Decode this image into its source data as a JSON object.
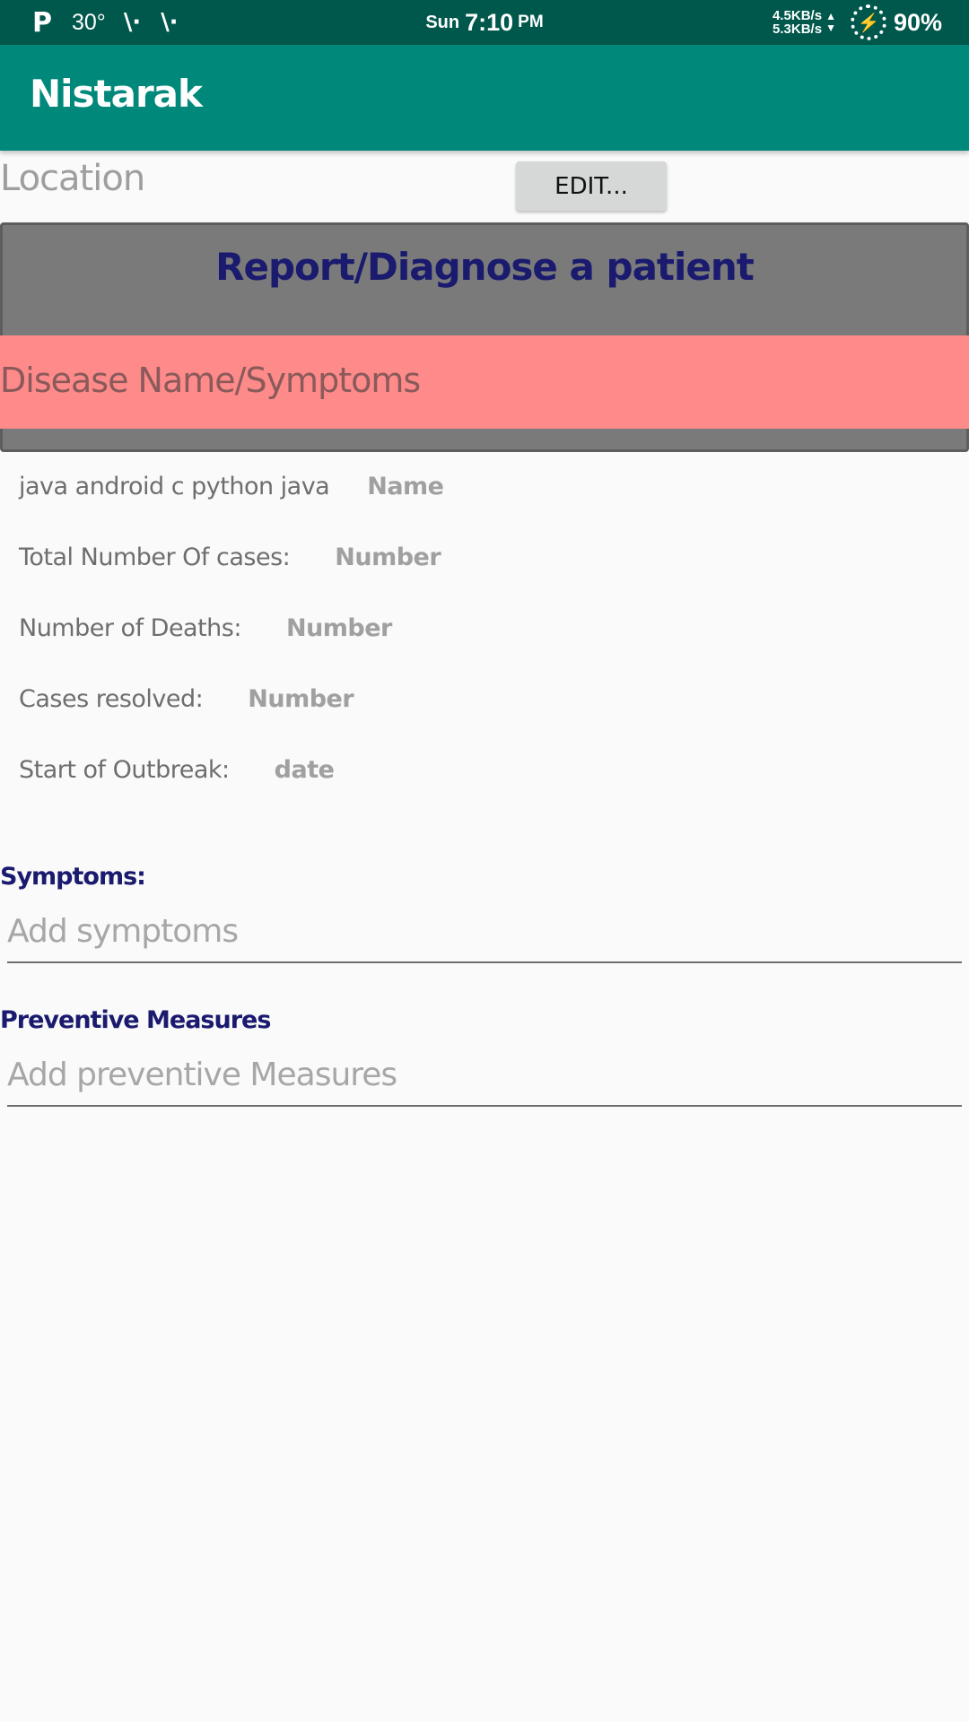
{
  "status_bar": {
    "p_icon": "P",
    "temperature": "30°",
    "signal_icons": [
      "\\·",
      "\\·"
    ],
    "day": "Sun",
    "time": "7:10",
    "ampm": "PM",
    "upload_speed": "4.5KB/s",
    "download_speed": "5.3KB/s",
    "battery": "90%"
  },
  "app_bar": {
    "title": "Nistarak"
  },
  "location": {
    "label": "Location",
    "edit_button": "EDIT..."
  },
  "report": {
    "title": "Report/Diagnose a patient",
    "disease_label": "Disease Name/Symptoms"
  },
  "stats": [
    {
      "label": "java android c python java",
      "value": "Name"
    },
    {
      "label": "Total Number Of cases:",
      "value": "Number"
    },
    {
      "label": "Number of Deaths:",
      "value": "Number"
    },
    {
      "label": "Cases resolved:",
      "value": "Number"
    },
    {
      "label": "Start of Outbreak:",
      "value": "date"
    }
  ],
  "symptoms": {
    "heading": "Symptoms:",
    "placeholder": "Add symptoms"
  },
  "preventive": {
    "heading": "Preventive Measures",
    "placeholder": "Add preventive Measures"
  },
  "colors": {
    "status_bar": "#00574b",
    "app_bar": "#00897b",
    "report_card": "#7a7a7a",
    "disease_band": "#ff8a8a",
    "heading_navy": "#1a1a6e"
  }
}
